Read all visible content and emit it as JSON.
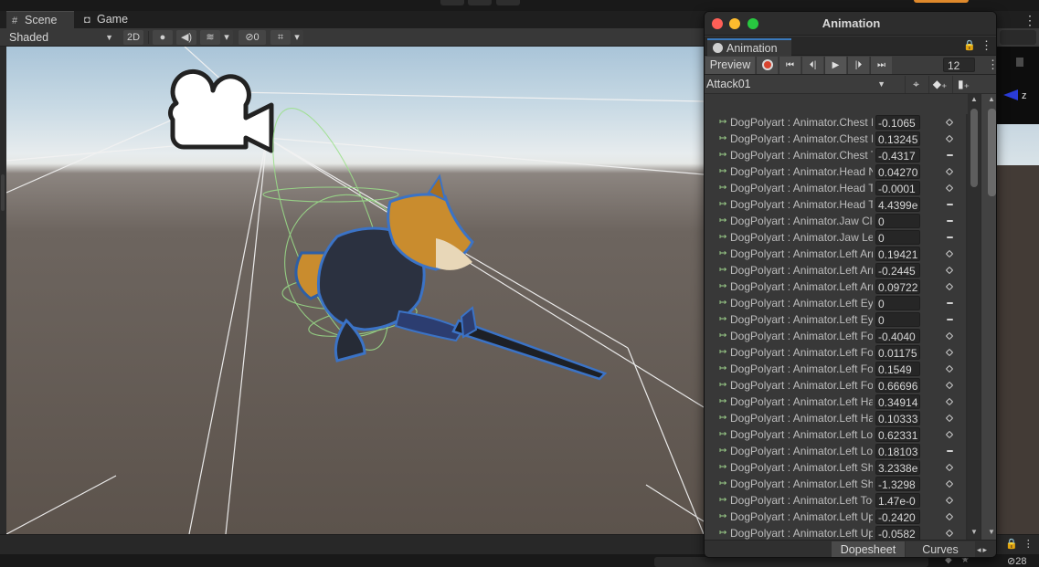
{
  "scene_window": {
    "tabs": [
      {
        "label": "Scene",
        "icon": "grid-icon"
      },
      {
        "label": "Game",
        "icon": "gamepad-icon"
      }
    ],
    "toolbar": {
      "shading_mode": "Shaded",
      "mode_2d": "2D",
      "hidden_count": "0"
    },
    "stats_count": "28"
  },
  "animation_window": {
    "title": "Animation",
    "tab_label": "Animation",
    "preview_label": "Preview",
    "frame": "12",
    "clip": "Attack01",
    "properties": [
      {
        "name": "DogPolyart : Animator.Chest Front-Back",
        "value": "-0.1065",
        "key": "diamond"
      },
      {
        "name": "DogPolyart : Animator.Chest Left-Right",
        "value": "0.13245",
        "key": "diamond"
      },
      {
        "name": "DogPolyart : Animator.Chest Twist Left-Right",
        "value": "-0.4317",
        "key": "dash"
      },
      {
        "name": "DogPolyart : Animator.Head Nod Down-Up",
        "value": "0.04270",
        "key": "diamond"
      },
      {
        "name": "DogPolyart : Animator.Head Tilt Left-Right",
        "value": "-0.0001",
        "key": "diamond"
      },
      {
        "name": "DogPolyart : Animator.Head Turn Left-Right",
        "value": "4.4399e",
        "key": "dash"
      },
      {
        "name": "DogPolyart : Animator.Jaw Close",
        "value": "0",
        "key": "dash"
      },
      {
        "name": "DogPolyart : Animator.Jaw Left-Right",
        "value": "0",
        "key": "dash"
      },
      {
        "name": "DogPolyart : Animator.Left Arm Down-Up",
        "value": "0.19421",
        "key": "diamond"
      },
      {
        "name": "DogPolyart : Animator.Left Arm Front-Back",
        "value": "-0.2445",
        "key": "diamond"
      },
      {
        "name": "DogPolyart : Animator.Left Arm Twist In-Out",
        "value": "0.09722",
        "key": "diamond"
      },
      {
        "name": "DogPolyart : Animator.Left Eye Down-Up",
        "value": "0",
        "key": "dash"
      },
      {
        "name": "DogPolyart : Animator.Left Eye In-Out",
        "value": "0",
        "key": "dash"
      },
      {
        "name": "DogPolyart : Animator.Left Foot Twist In-Out",
        "value": "-0.4040",
        "key": "diamond"
      },
      {
        "name": "DogPolyart : Animator.Left Foot Up-Down",
        "value": "0.01175",
        "key": "diamond"
      },
      {
        "name": "DogPolyart : Animator.Left Forearm Stretch",
        "value": "0.1549",
        "key": "diamond"
      },
      {
        "name": "DogPolyart : Animator.Left Forearm Twist In-Out",
        "value": "0.66696",
        "key": "diamond"
      },
      {
        "name": "DogPolyart : Animator.Left Hand Down-Up",
        "value": "0.34914",
        "key": "diamond"
      },
      {
        "name": "DogPolyart : Animator.Left Hand In-Out",
        "value": "0.10333",
        "key": "diamond"
      },
      {
        "name": "DogPolyart : Animator.Left Lower Leg Stretch",
        "value": "0.62331",
        "key": "diamond"
      },
      {
        "name": "DogPolyart : Animator.Left Lower Leg Twist In-Out",
        "value": "0.18103",
        "key": "dash"
      },
      {
        "name": "DogPolyart : Animator.Left Shoulder Down-Up",
        "value": "3.2338e",
        "key": "diamond"
      },
      {
        "name": "DogPolyart : Animator.Left Shoulder Front-Back",
        "value": "-1.3298",
        "key": "diamond"
      },
      {
        "name": "DogPolyart : Animator.Left Toes Up-Down",
        "value": "1.47e-0",
        "key": "diamond"
      },
      {
        "name": "DogPolyart : Animator.Left Upper Leg Front-Back",
        "value": "-0.2420",
        "key": "diamond"
      },
      {
        "name": "DogPolyart : Animator.Left Upper Leg In-Out",
        "value": "-0.0582",
        "key": "diamond"
      }
    ],
    "bottom_tabs": {
      "dopesheet": "Dopesheet",
      "curves": "Curves"
    }
  },
  "colors": {
    "record": "#d8442f",
    "close_light": "#ff5f57",
    "minimize_light": "#febc2e",
    "zoom_light": "#28c840",
    "active_tab_accent": "#3a79bb",
    "property_arrow": "#9ed28c"
  }
}
